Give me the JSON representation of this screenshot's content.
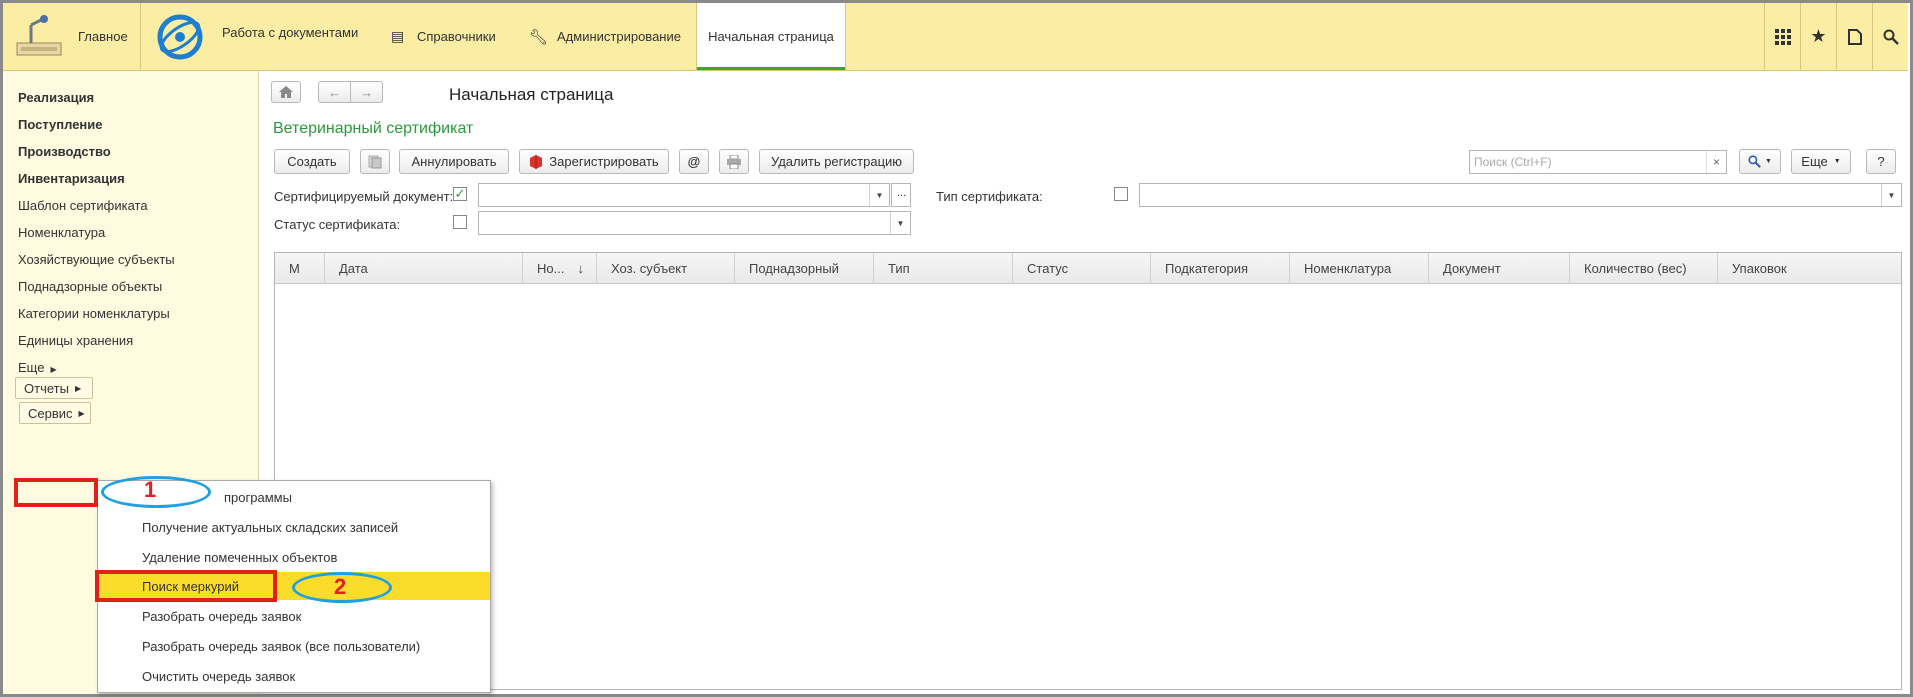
{
  "topbar": {
    "home_label": "Главное",
    "documents_label": "Работа с документами",
    "references_label": "Справочники",
    "admin_label": "Администрирование",
    "active_tab": "Начальная страница"
  },
  "sidebar": {
    "items": [
      {
        "label": "Реализация",
        "bold": true
      },
      {
        "label": "Поступление",
        "bold": true
      },
      {
        "label": "Производство",
        "bold": true
      },
      {
        "label": "Инвентаризация",
        "bold": true
      },
      {
        "label": "Шаблон сертификата",
        "bold": false
      },
      {
        "label": "Номенклатура",
        "bold": false
      },
      {
        "label": "Хозяйствующие субъекты",
        "bold": false
      },
      {
        "label": "Поднадзорные объекты",
        "bold": false
      },
      {
        "label": "Категории номенклатуры",
        "bold": false
      },
      {
        "label": "Единицы хранения",
        "bold": false
      }
    ],
    "more_label": "Еще",
    "reports_label": "Отчеты",
    "service_label": "Сервис"
  },
  "main": {
    "page_title": "Начальная страница",
    "form_title": "Ветеринарный сертификат",
    "toolbar": {
      "create": "Создать",
      "cancel": "Аннулировать",
      "register": "Зарегистрировать",
      "at": "@",
      "delete_registration": "Удалить регистрацию",
      "search_placeholder": "Поиск (Ctrl+F)",
      "more": "Еще",
      "help": "?"
    },
    "filters": {
      "cert_doc_label": "Сертифицируемый документ:",
      "cert_type_label": "Тип сертификата:",
      "cert_status_label": "Статус сертификата:"
    },
    "table_columns": [
      "М",
      "Дата",
      "Но...",
      "Хоз. субъект",
      "Поднадзорный",
      "Тип",
      "Статус",
      "Подкатегория",
      "Номенклатура",
      "Документ",
      "Количество (вес)",
      "Упаковок"
    ]
  },
  "service_menu": {
    "items": [
      "программы",
      "Получение актуальных складских записей",
      "Удаление помеченных объектов",
      "Поиск меркурий",
      "Разобрать очередь заявок",
      "Разобрать очередь заявок (все пользователи)",
      "Очистить очередь заявок"
    ],
    "selected_index": 3
  },
  "annotations": {
    "step1": "1",
    "step2": "2"
  },
  "colors": {
    "topbar_bg": "#fbeda3",
    "sidebar_bg": "#fefbe0",
    "form_title": "#2b9a3a",
    "menu_highlight": "#fcdc2b",
    "annotation_red": "#e0201b",
    "annotation_blue": "#20a0e0"
  }
}
